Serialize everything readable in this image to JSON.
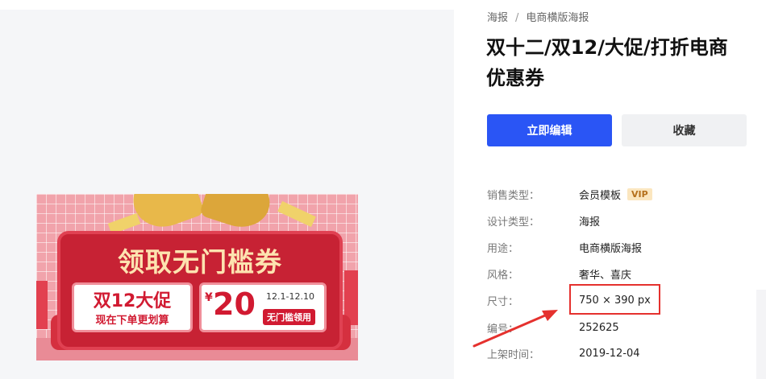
{
  "breadcrumb": {
    "items": [
      "海报",
      "电商横版海报"
    ],
    "separator": "/"
  },
  "title": "双十二/双12/大促/打折电商优惠券",
  "buttons": {
    "edit": "立即编辑",
    "favorite": "收藏"
  },
  "info": [
    {
      "label": "销售类型：",
      "value": "会员模板",
      "badge": "VIP"
    },
    {
      "label": "设计类型：",
      "value": "海报"
    },
    {
      "label": "用途：",
      "value": "电商横版海报"
    },
    {
      "label": "风格：",
      "value": "奢华、喜庆"
    },
    {
      "label": "尺寸：",
      "value": "750 × 390 px"
    },
    {
      "label": "编号：",
      "value": "252625"
    },
    {
      "label": "上架时间：",
      "value": "2019-12-04"
    }
  ],
  "poster": {
    "headline": "领取无门槛券",
    "left_card": {
      "big": "双12大促",
      "small": "现在下单更划算"
    },
    "right_card": {
      "currency": "¥",
      "amount": "20",
      "dates": "12.1-12.10",
      "tag": "无门槛领用"
    }
  },
  "colors": {
    "primary_button": "#2a55f5",
    "highlight": "#e5312e",
    "poster_red": "#d11a31",
    "vip_badge_bg": "#fbe6bf"
  },
  "annotation": {
    "icon": "arrow-icon",
    "target": "尺寸：750 × 390 px"
  }
}
